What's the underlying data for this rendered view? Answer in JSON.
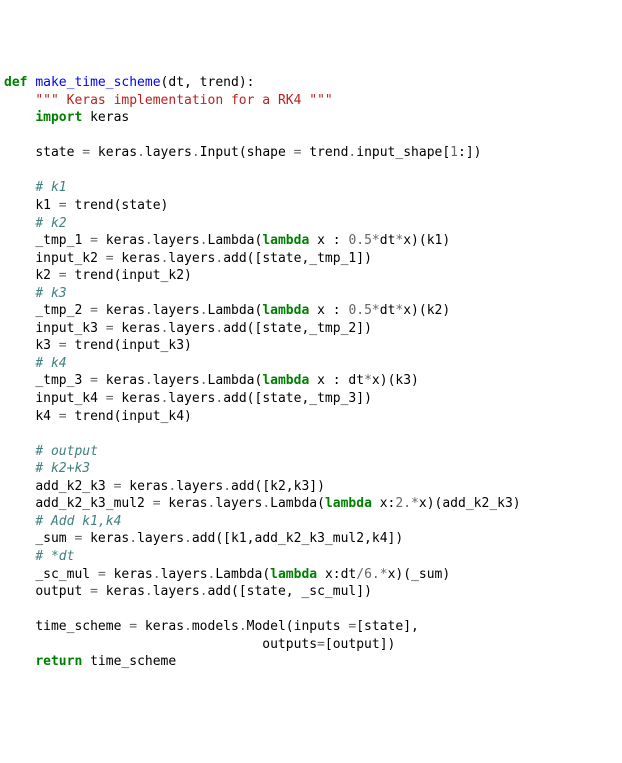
{
  "code": {
    "l01_def": "def",
    "l01_name": "make_time_scheme",
    "l01_rest": "(dt, trend):",
    "l02_doc": "\"\"\" Keras implementation for a RK4 \"\"\"",
    "l03_import": "import",
    "l03_mod": "keras",
    "l05_a": "state ",
    "l05_eq": "=",
    "l05_b": " keras",
    "l05_d1": ".",
    "l05_c": "layers",
    "l05_d2": ".",
    "l05_d": "Input(shape ",
    "l05_eq2": "=",
    "l05_e": " trend",
    "l05_d3": ".",
    "l05_f": "input_shape[",
    "l05_n1": "1",
    "l05_g": ":])",
    "l07_c": "# k1",
    "l08_a": "k1 ",
    "l08_eq": "=",
    "l08_b": " trend(state)",
    "l09_c": "# k2",
    "l10_a": "_tmp_1 ",
    "l10_eq": "=",
    "l10_b": " keras",
    "l10_d1": ".",
    "l10_c2": "layers",
    "l10_d2": ".",
    "l10_d": "Lambda(",
    "l10_lam": "lambda",
    "l10_e": " x : ",
    "l10_n": "0.5",
    "l10_m1": "*",
    "l10_f": "dt",
    "l10_m2": "*",
    "l10_g": "x)(k1)",
    "l11_a": "input_k2 ",
    "l11_eq": "=",
    "l11_b": " keras",
    "l11_d1": ".",
    "l11_c": "layers",
    "l11_d2": ".",
    "l11_d": "add([state,_tmp_1])",
    "l12_a": "k2 ",
    "l12_eq": "=",
    "l12_b": " trend(input_k2)",
    "l13_c": "# k3",
    "l14_a": "_tmp_2 ",
    "l14_eq": "=",
    "l14_b": " keras",
    "l14_d1": ".",
    "l14_c2": "layers",
    "l14_d2": ".",
    "l14_d": "Lambda(",
    "l14_lam": "lambda",
    "l14_e": " x : ",
    "l14_n": "0.5",
    "l14_m1": "*",
    "l14_f": "dt",
    "l14_m2": "*",
    "l14_g": "x)(k2)",
    "l15_a": "input_k3 ",
    "l15_eq": "=",
    "l15_b": " keras",
    "l15_d1": ".",
    "l15_c": "layers",
    "l15_d2": ".",
    "l15_d": "add([state,_tmp_2])",
    "l16_a": "k3 ",
    "l16_eq": "=",
    "l16_b": " trend(input_k3)",
    "l17_c": "# k4",
    "l18_a": "_tmp_3 ",
    "l18_eq": "=",
    "l18_b": " keras",
    "l18_d1": ".",
    "l18_c2": "layers",
    "l18_d2": ".",
    "l18_d": "Lambda(",
    "l18_lam": "lambda",
    "l18_e": " x : dt",
    "l18_m2": "*",
    "l18_g": "x)(k3)",
    "l19_a": "input_k4 ",
    "l19_eq": "=",
    "l19_b": " keras",
    "l19_d1": ".",
    "l19_c": "layers",
    "l19_d2": ".",
    "l19_d": "add([state,_tmp_3])",
    "l20_a": "k4 ",
    "l20_eq": "=",
    "l20_b": " trend(input_k4)",
    "l22_c": "# output",
    "l23_c": "# k2+k3",
    "l24_a": "add_k2_k3 ",
    "l24_eq": "=",
    "l24_b": " keras",
    "l24_d1": ".",
    "l24_c2": "layers",
    "l24_d2": ".",
    "l24_d": "add([k2,k3])",
    "l25_a": "add_k2_k3_mul2 ",
    "l25_eq": "=",
    "l25_b": " keras",
    "l25_d1": ".",
    "l25_c2": "layers",
    "l25_d2": ".",
    "l25_d": "Lambda(",
    "l25_lam": "lambda",
    "l25_e": " x:",
    "l25_n": "2.",
    "l25_m": "*",
    "l25_f": "x)(add_k2_k3)",
    "l26_c": "# Add k1,k4",
    "l27_a": "_sum ",
    "l27_eq": "=",
    "l27_b": " keras",
    "l27_d1": ".",
    "l27_c2": "layers",
    "l27_d2": ".",
    "l27_d": "add([k1,add_k2_k3_mul2,k4])",
    "l28_c": "# *dt",
    "l29_a": "_sc_mul ",
    "l29_eq": "=",
    "l29_b": " keras",
    "l29_d1": ".",
    "l29_c2": "layers",
    "l29_d2": ".",
    "l29_d": "Lambda(",
    "l29_lam": "lambda",
    "l29_e": " x:dt",
    "l29_sl": "/",
    "l29_n": "6.",
    "l29_m": "*",
    "l29_f": "x)(_sum)",
    "l30_a": "output ",
    "l30_eq": "=",
    "l30_b": " keras",
    "l30_d1": ".",
    "l30_c2": "layers",
    "l30_d2": ".",
    "l30_d": "add([state, _sc_mul])",
    "l32_a": "time_scheme ",
    "l32_eq": "=",
    "l32_b": " keras",
    "l32_d1": ".",
    "l32_c2": "models",
    "l32_d2": ".",
    "l32_d": "Model(inputs ",
    "l32_eq2": "=",
    "l32_e": "[state],",
    "l33_a": "                                 outputs",
    "l33_eq": "=",
    "l33_b": "[output])",
    "l34_ret": "return",
    "l34_b": " time_scheme"
  }
}
